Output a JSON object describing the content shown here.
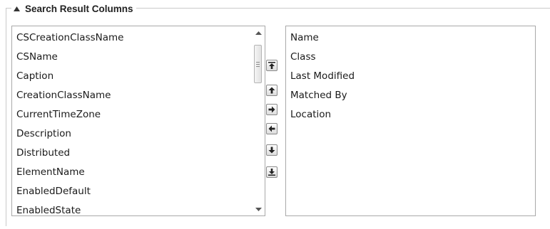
{
  "group": {
    "title": "Search Result Columns",
    "collapse_icon": "triangle-up-icon"
  },
  "available_columns": {
    "items": [
      "CSCreationClassName",
      "CSName",
      "Caption",
      "CreationClassName",
      "CurrentTimeZone",
      "Description",
      "Distributed",
      "ElementName",
      "EnabledDefault",
      "EnabledState"
    ],
    "scroll": {
      "up_icon": "scroll-up-arrow-icon",
      "down_icon": "scroll-down-arrow-icon",
      "thumb_grip_icon": "grip-icon"
    }
  },
  "selected_columns": {
    "items": [
      "Name",
      "Class",
      "Last Modified",
      "Matched By",
      "Location"
    ]
  },
  "mover_buttons": [
    {
      "name": "move-to-top-button",
      "icon": "double-arrow-up-icon"
    },
    {
      "name": "move-up-button",
      "icon": "arrow-up-icon"
    },
    {
      "name": "add-column-button",
      "icon": "arrow-right-icon"
    },
    {
      "name": "remove-column-button",
      "icon": "arrow-left-icon"
    },
    {
      "name": "move-down-button",
      "icon": "arrow-down-icon"
    },
    {
      "name": "move-to-bottom-button",
      "icon": "double-arrow-down-icon"
    }
  ]
}
